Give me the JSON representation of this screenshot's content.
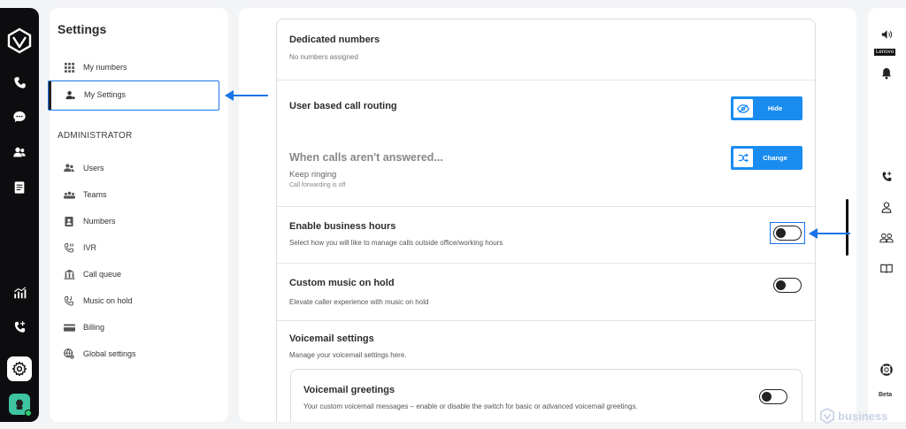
{
  "sidebar": {
    "title": "Settings",
    "items": [
      {
        "label": "My numbers",
        "icon": "grid-icon"
      },
      {
        "label": "My Settings",
        "icon": "user-gear-icon"
      }
    ],
    "admin_title": "ADMINISTRATOR",
    "admin_items": [
      {
        "label": "Users",
        "icon": "users-icon"
      },
      {
        "label": "Teams",
        "icon": "teams-icon"
      },
      {
        "label": "Numbers",
        "icon": "id-card-icon"
      },
      {
        "label": "IVR",
        "icon": "ivr-icon"
      },
      {
        "label": "Call queue",
        "icon": "call-queue-icon"
      },
      {
        "label": "Music on hold",
        "icon": "music-phone-icon"
      },
      {
        "label": "Billing",
        "icon": "card-icon"
      },
      {
        "label": "Global settings",
        "icon": "globe-gear-icon"
      }
    ]
  },
  "main": {
    "dedicated": {
      "title": "Dedicated numbers",
      "subtitle": "No numbers assigned"
    },
    "routing": {
      "title": "User based call routing",
      "button": "Hide"
    },
    "unanswered": {
      "title": "When calls aren't answered...",
      "value": "Keep ringing",
      "note": "Call forwarding is off",
      "button": "Change"
    },
    "business_hours": {
      "title": "Enable business hours",
      "subtitle": "Select how you will like to manage calls outside office/working hours",
      "enabled": false
    },
    "music": {
      "title": "Custom music on hold",
      "subtitle": "Elevate caller experience with music on hold",
      "enabled": false
    },
    "voicemail": {
      "title": "Voicemail settings",
      "subtitle": "Manage your voicemail settings here."
    },
    "greetings": {
      "title": "Voicemail greetings",
      "subtitle": "Your custom voicemail messages – enable or disable the switch for basic or advanced voicemail greetings.",
      "enabled": false
    }
  },
  "right_rail": {
    "lenovo": "Lenovo",
    "beta": "Beta"
  },
  "watermark": "business",
  "colors": {
    "accent": "#1a8cf0",
    "highlight": "#1a73e8",
    "rail": "#0d0d0f"
  }
}
